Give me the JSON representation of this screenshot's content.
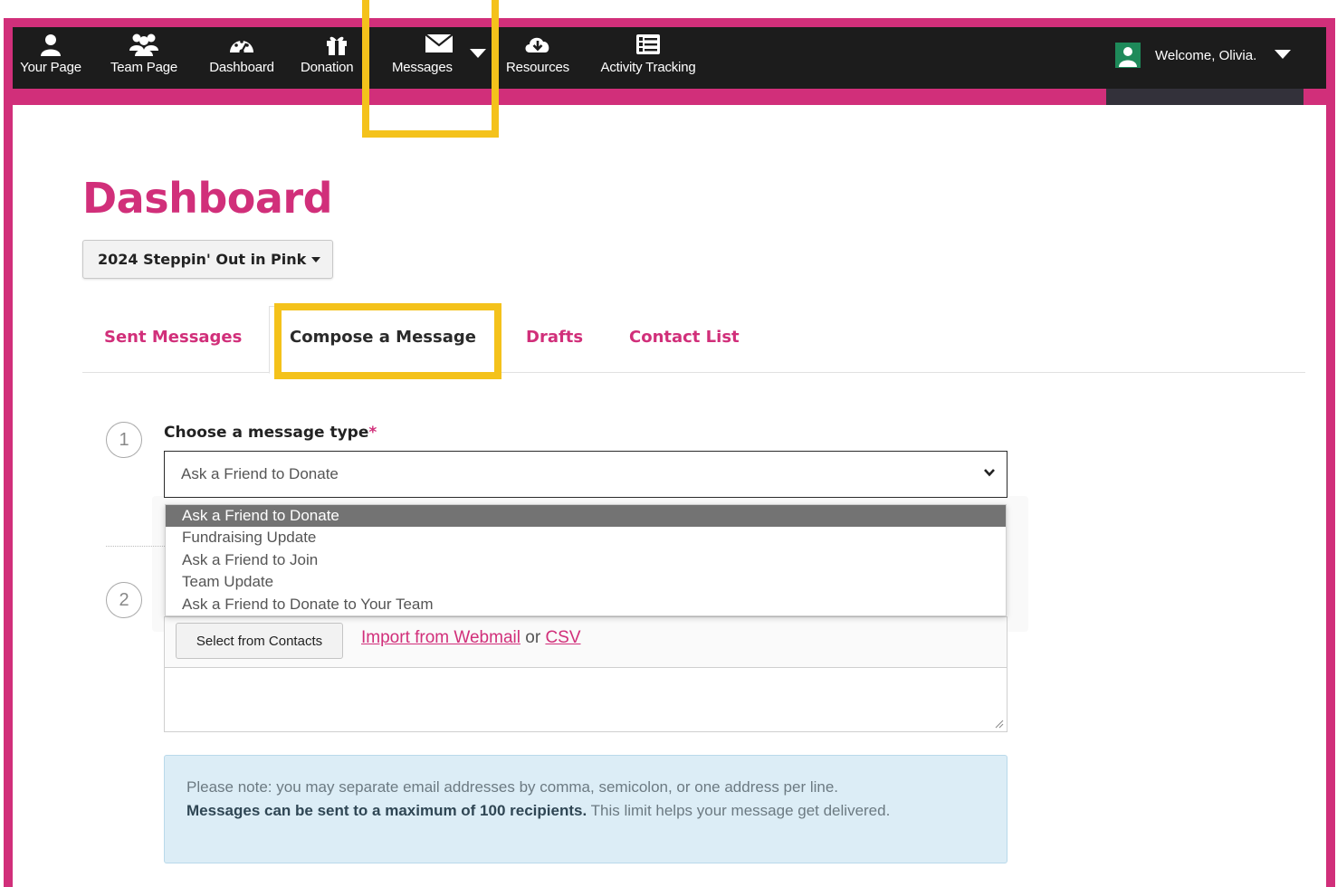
{
  "nav": {
    "items": [
      {
        "label": "Your Page",
        "icon": "user-icon"
      },
      {
        "label": "Team Page",
        "icon": "team-icon"
      },
      {
        "label": "Dashboard",
        "icon": "dashboard-gauge-icon"
      },
      {
        "label": "Donation",
        "icon": "gift-icon"
      },
      {
        "label": "Messages",
        "icon": "envelope-icon"
      },
      {
        "label": "Resources",
        "icon": "cloud-download-icon"
      },
      {
        "label": "Activity Tracking",
        "icon": "list-icon"
      }
    ],
    "welcome": "Welcome, Olivia."
  },
  "page": {
    "title": "Dashboard",
    "event_selector": "2024 Steppin' Out in Pink"
  },
  "tabs": [
    {
      "label": "Sent Messages"
    },
    {
      "label": "Compose a Message"
    },
    {
      "label": "Drafts"
    },
    {
      "label": "Contact List"
    }
  ],
  "step1": {
    "number": "1",
    "label": "Choose a message type",
    "required_mark": "*",
    "selected": "Ask a Friend to Donate",
    "options": [
      "Ask a Friend to Donate",
      "Fundraising Update",
      "Ask a Friend to Join",
      "Team Update",
      "Ask a Friend to Donate to Your Team"
    ]
  },
  "step2": {
    "number": "2",
    "select_contacts": "Select from Contacts",
    "import_webmail": "Import from Webmail",
    "or": "or",
    "csv": "CSV"
  },
  "note": {
    "text1": "Please note: you may separate email addresses by comma, semicolon, or one address per line.",
    "bold": "Messages can be sent to a maximum of 100 recipients.",
    "text2": "This limit helps your message get delivered."
  },
  "colors": {
    "brand": "#d12f7a",
    "nav_bg": "#1c1c1c",
    "highlight": "#f4c21b",
    "note_bg": "#dcedf6"
  }
}
